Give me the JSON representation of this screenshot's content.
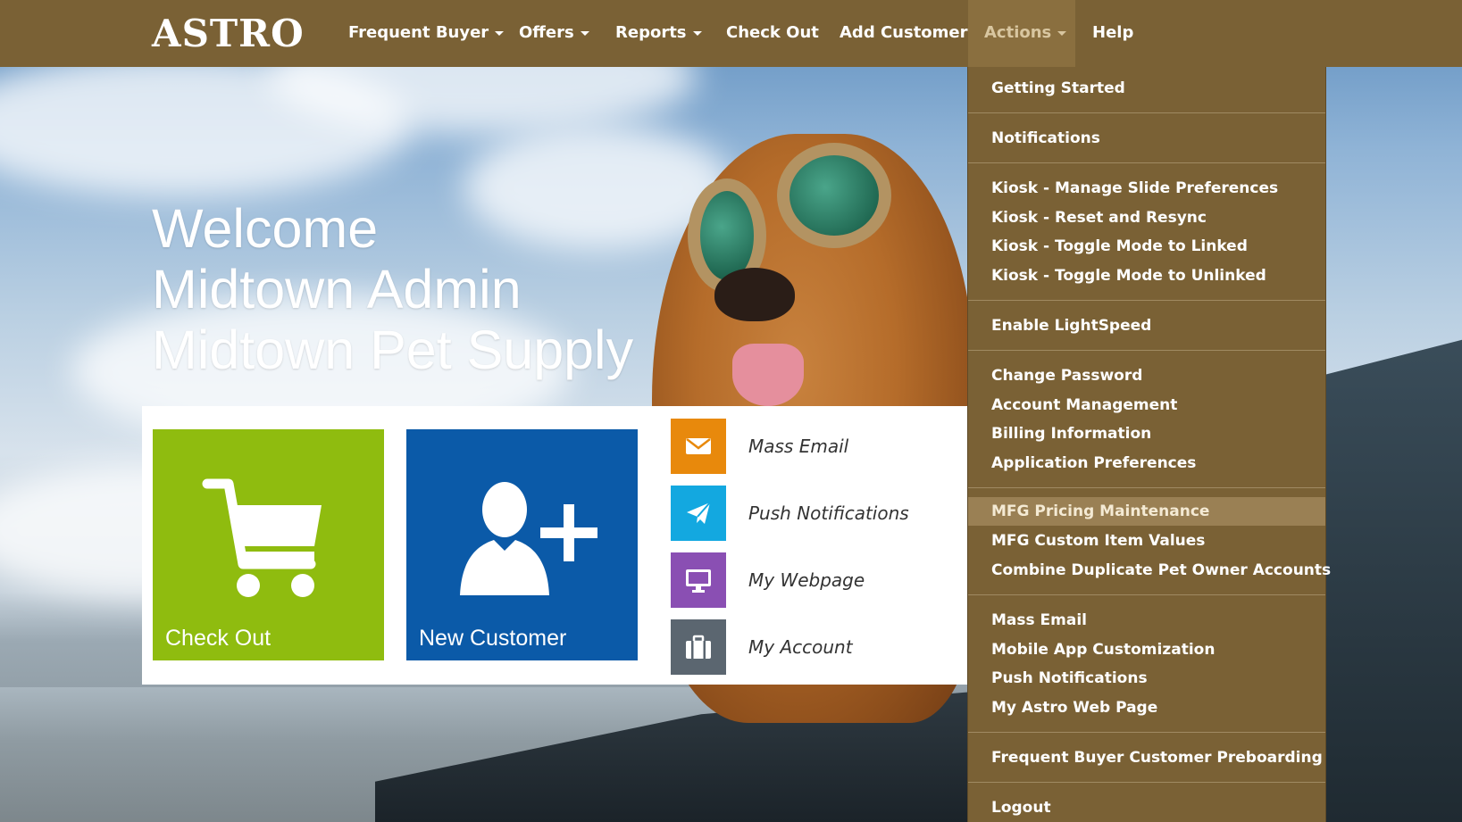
{
  "brand": {
    "logo": "ASTRO"
  },
  "nav": {
    "items": [
      {
        "label": "Frequent Buyer",
        "dropdown": true
      },
      {
        "label": "Offers",
        "dropdown": true
      },
      {
        "label": "Reports",
        "dropdown": true
      },
      {
        "label": "Check Out",
        "dropdown": false
      },
      {
        "label": "Add Customer",
        "dropdown": false
      },
      {
        "label": "Actions",
        "dropdown": true,
        "active": true
      },
      {
        "label": "Help",
        "dropdown": false
      }
    ]
  },
  "welcome": {
    "line1": "Welcome",
    "line2": "Midtown Admin",
    "line3": "Midtown Pet Supply"
  },
  "tiles": {
    "checkout": {
      "label": "Check Out",
      "color": "#8fbc0f"
    },
    "new_customer": {
      "label": "New Customer",
      "color": "#0b5aa8"
    }
  },
  "quick_actions": [
    {
      "label": "Mass Email",
      "icon": "envelope-icon",
      "color": "#e8890c"
    },
    {
      "label": "Push Notifications",
      "icon": "paper-plane-icon",
      "color": "#13a8e0"
    },
    {
      "label": "My Webpage",
      "icon": "monitor-icon",
      "color": "#8a4fb3"
    },
    {
      "label": "My Account",
      "icon": "briefcase-icon",
      "color": "#5b6670"
    }
  ],
  "actions_menu": {
    "items": [
      {
        "label": "Getting Started"
      },
      {
        "label": "Notifications"
      },
      {
        "label": "Kiosk - Manage Slide Preferences"
      },
      {
        "label": "Kiosk - Reset and Resync"
      },
      {
        "label": "Kiosk - Toggle Mode to Linked"
      },
      {
        "label": "Kiosk - Toggle Mode to Unlinked"
      },
      {
        "label": "Enable LightSpeed"
      },
      {
        "label": "Change Password"
      },
      {
        "label": "Account Management"
      },
      {
        "label": "Billing Information"
      },
      {
        "label": "Application Preferences"
      },
      {
        "label": "MFG Pricing Maintenance",
        "highlighted": true
      },
      {
        "label": "MFG Custom Item Values"
      },
      {
        "label": "Combine Duplicate Pet Owner Accounts"
      },
      {
        "label": "Mass Email"
      },
      {
        "label": "Mobile App Customization"
      },
      {
        "label": "Push Notifications"
      },
      {
        "label": "My Astro Web Page"
      },
      {
        "label": "Frequent Buyer Customer Preboarding"
      },
      {
        "label": "Logout"
      }
    ]
  },
  "colors": {
    "navbar": "#7a6135",
    "menu_highlight": "#9a8054"
  }
}
